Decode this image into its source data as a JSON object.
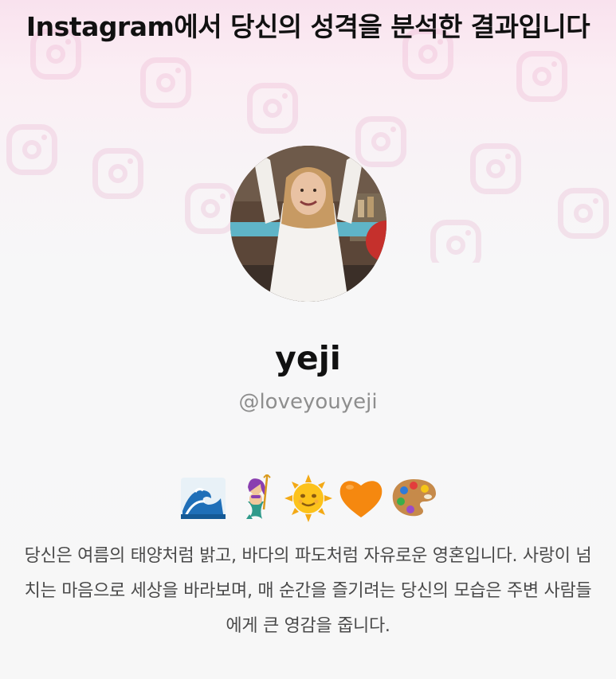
{
  "header": {
    "title": "Instagram에서 당신의 성격을 분석한 결과입니다"
  },
  "profile": {
    "avatar_icon": "profile-photo",
    "name": "yeji",
    "handle": "@loveyouyeji"
  },
  "emojis": [
    {
      "icon": "wave-emoji"
    },
    {
      "icon": "mermaid-emoji"
    },
    {
      "icon": "sun-face-emoji"
    },
    {
      "icon": "orange-heart-emoji"
    },
    {
      "icon": "artist-palette-emoji"
    }
  ],
  "result": {
    "description": "당신은 여름의 태양처럼 밝고, 바다의 파도처럼 자유로운 영혼입니다. 사랑이 넘치는 마음으로 세상을 바라보며, 매 순간을 즐기려는 당신의 모습은 주변 사람들에게 큰 영감을 줍니다."
  },
  "colors": {
    "background_top": "#f9e2ee",
    "background": "#f7f7f7",
    "title_text": "#111111",
    "handle_text": "#8e8e8e",
    "description_text": "#4a4a4a"
  }
}
